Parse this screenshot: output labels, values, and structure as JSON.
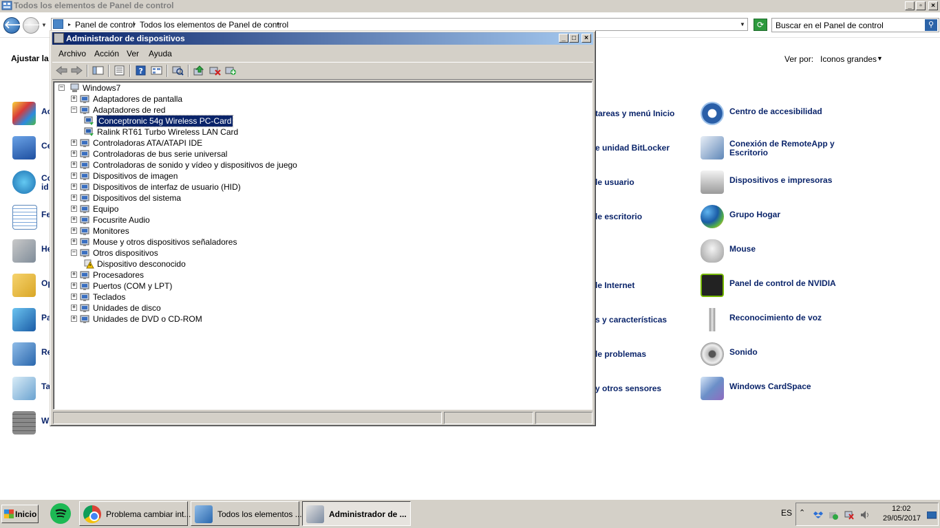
{
  "cp": {
    "title": "Todos los elementos de Panel de control",
    "breadcrumb": [
      "Panel de control",
      "Todos los elementos de Panel de control"
    ],
    "search_placeholder": "Buscar en el Panel de control",
    "adjust": "Ajustar la",
    "view_by": "Ver por:",
    "view_value": "Iconos grandes",
    "left_items": [
      "Ac",
      "Ce",
      "Co\nid",
      "Fe",
      "He",
      "Op",
      "Pa",
      "Re",
      "Ta",
      "W"
    ],
    "mid_items": [
      "tareas y menú Inicio",
      "e unidad BitLocker",
      "le usuario",
      "le escritorio",
      "le Internet",
      "s y características",
      "le problemas",
      "y otros sensores"
    ],
    "right_items": [
      "Centro de accesibilidad",
      "Conexión de RemoteApp y\nEscritorio",
      "Dispositivos e impresoras",
      "Grupo Hogar",
      "Mouse",
      "Panel de control de NVIDIA",
      "Reconocimiento de voz",
      "Sonido",
      "Windows CardSpace"
    ]
  },
  "dm": {
    "title": "Administrador de dispositivos",
    "menu": [
      "Archivo",
      "Acción",
      "Ver",
      "Ayuda"
    ],
    "root": "Windows7",
    "nodes": [
      {
        "label": "Adaptadores de pantalla",
        "level": 1,
        "state": "collapsed"
      },
      {
        "label": "Adaptadores de red",
        "level": 1,
        "state": "expanded"
      },
      {
        "label": "Conceptronic 54g Wireless PC-Card",
        "level": 2,
        "state": "leaf",
        "selected": true
      },
      {
        "label": "Ralink RT61 Turbo Wireless LAN Card",
        "level": 2,
        "state": "leaf"
      },
      {
        "label": "Controladoras ATA/ATAPI IDE",
        "level": 1,
        "state": "collapsed"
      },
      {
        "label": "Controladoras de bus serie universal",
        "level": 1,
        "state": "collapsed"
      },
      {
        "label": "Controladoras de sonido y vídeo y dispositivos de juego",
        "level": 1,
        "state": "collapsed"
      },
      {
        "label": "Dispositivos de imagen",
        "level": 1,
        "state": "collapsed"
      },
      {
        "label": "Dispositivos de interfaz de usuario (HID)",
        "level": 1,
        "state": "collapsed"
      },
      {
        "label": "Dispositivos del sistema",
        "level": 1,
        "state": "collapsed"
      },
      {
        "label": "Equipo",
        "level": 1,
        "state": "collapsed"
      },
      {
        "label": "Focusrite Audio",
        "level": 1,
        "state": "collapsed"
      },
      {
        "label": "Monitores",
        "level": 1,
        "state": "collapsed"
      },
      {
        "label": "Mouse y otros dispositivos señaladores",
        "level": 1,
        "state": "collapsed"
      },
      {
        "label": "Otros dispositivos",
        "level": 1,
        "state": "expanded"
      },
      {
        "label": "Dispositivo desconocido",
        "level": 2,
        "state": "leaf",
        "warning": true
      },
      {
        "label": "Procesadores",
        "level": 1,
        "state": "collapsed"
      },
      {
        "label": "Puertos (COM y LPT)",
        "level": 1,
        "state": "collapsed"
      },
      {
        "label": "Teclados",
        "level": 1,
        "state": "collapsed"
      },
      {
        "label": "Unidades de disco",
        "level": 1,
        "state": "collapsed"
      },
      {
        "label": "Unidades de DVD o CD-ROM",
        "level": 1,
        "state": "collapsed"
      }
    ]
  },
  "taskbar": {
    "start": "Inicio",
    "buttons": [
      {
        "label": "Problema cambiar int...",
        "icon": "chrome-icon"
      },
      {
        "label": "Todos los elementos ...",
        "icon": "control-panel-icon"
      },
      {
        "label": "Administrador de ...",
        "icon": "device-manager-icon",
        "active": true
      }
    ],
    "lang": "ES",
    "time": "12:02",
    "date": "29/05/2017"
  }
}
